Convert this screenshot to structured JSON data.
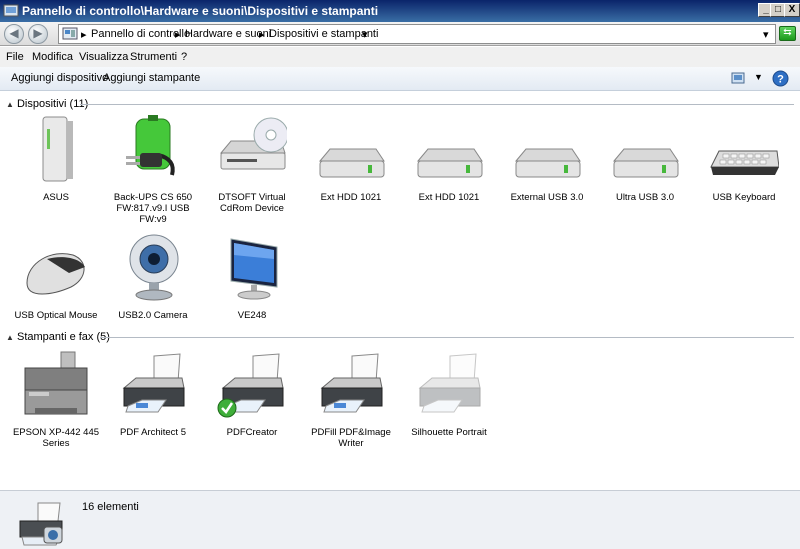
{
  "window": {
    "title": "Pannello di controllo\\Hardware e suoni\\Dispositivi e stampanti",
    "minimize": "_",
    "maximize": "□",
    "close": "X"
  },
  "address": {
    "crumbs": [
      "Pannello di controllo",
      "Hardware e suoni",
      "Dispositivi e stampanti"
    ]
  },
  "menu": [
    "File",
    "Modifica",
    "Visualizza",
    "Strumenti",
    "?"
  ],
  "commands": {
    "add_device": "Aggiungi dispositivo",
    "add_printer": "Aggiungi stampante"
  },
  "groups": {
    "devices": {
      "header": "Dispositivi (11)",
      "items": [
        {
          "label": "ASUS",
          "icon": "computer-tower-icon"
        },
        {
          "label": "Back-UPS CS 650 FW:817.v9.I USB FW:v9",
          "icon": "battery-plug-icon"
        },
        {
          "label": "DTSOFT Virtual CdRom Device",
          "icon": "cd-drive-icon"
        },
        {
          "label": "Ext HDD 1021",
          "icon": "hard-drive-icon"
        },
        {
          "label": "Ext HDD 1021",
          "icon": "hard-drive-icon"
        },
        {
          "label": "External USB 3.0",
          "icon": "hard-drive-icon"
        },
        {
          "label": "Ultra USB 3.0",
          "icon": "hard-drive-icon"
        },
        {
          "label": "USB Keyboard",
          "icon": "keyboard-icon"
        },
        {
          "label": "USB Optical Mouse",
          "icon": "mouse-icon"
        },
        {
          "label": "USB2.0 Camera",
          "icon": "webcam-icon"
        },
        {
          "label": "VE248",
          "icon": "monitor-icon"
        }
      ]
    },
    "printers": {
      "header": "Stampanti e fax (5)",
      "items": [
        {
          "label": "EPSON XP-442 445 Series",
          "icon": "multifunction-printer-icon"
        },
        {
          "label": "PDF Architect 5",
          "icon": "printer-icon"
        },
        {
          "label": "PDFCreator",
          "icon": "printer-default-icon"
        },
        {
          "label": "PDFill PDF&Image Writer",
          "icon": "printer-icon"
        },
        {
          "label": "Silhouette Portrait",
          "icon": "printer-faded-icon"
        }
      ]
    }
  },
  "status": {
    "count": "16 elementi"
  }
}
